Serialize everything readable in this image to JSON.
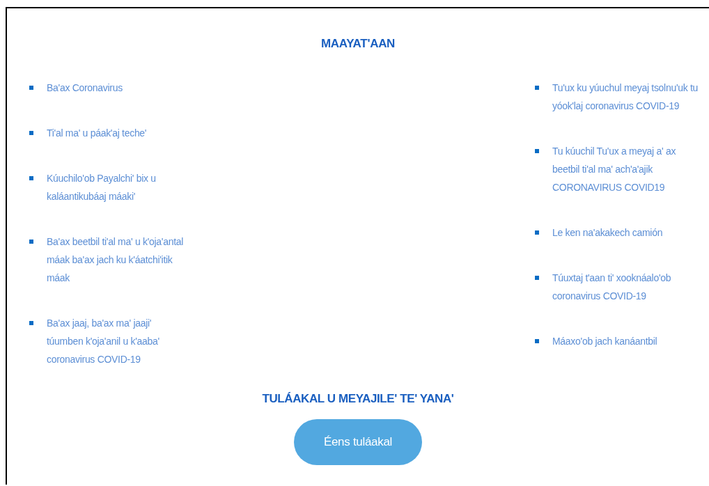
{
  "heading": "MAAYAT'AAN",
  "left_links": [
    "Ba'ax Coronavirus",
    "Ti'al ma' u páak'aj teche'",
    "Kúuchilo'ob Payalchi' bix u kaláantikubáaj máaki'",
    "Ba'ax beetbil ti'al ma' u k'oja'antal máak ba'ax jach ku k'áatchi'itik máak",
    "Ba'ax jaaj, ba'ax ma' jaaji' túumben k'oja'anil u k'aaba' coronavirus COVID-19"
  ],
  "right_links": [
    "Tu'ux ku yúuchul meyaj tsolnu'uk tu yóok'laj coronavirus COVID-19",
    "Tu kúuchil Tu'ux a meyaj a' ax beetbil ti'al ma' ach'a'ajik CORONAVIRUS COVID19",
    "Le ken na'akakech camión",
    "Túuxtaj t'aan ti' xooknáalo'ob coronavirus COVID-19",
    "Máaxo'ob jach kanáantbil"
  ],
  "subheading": "TULÁAKAL U MEYAJILE' TE' YANA'",
  "button": "Éens tuláakal"
}
